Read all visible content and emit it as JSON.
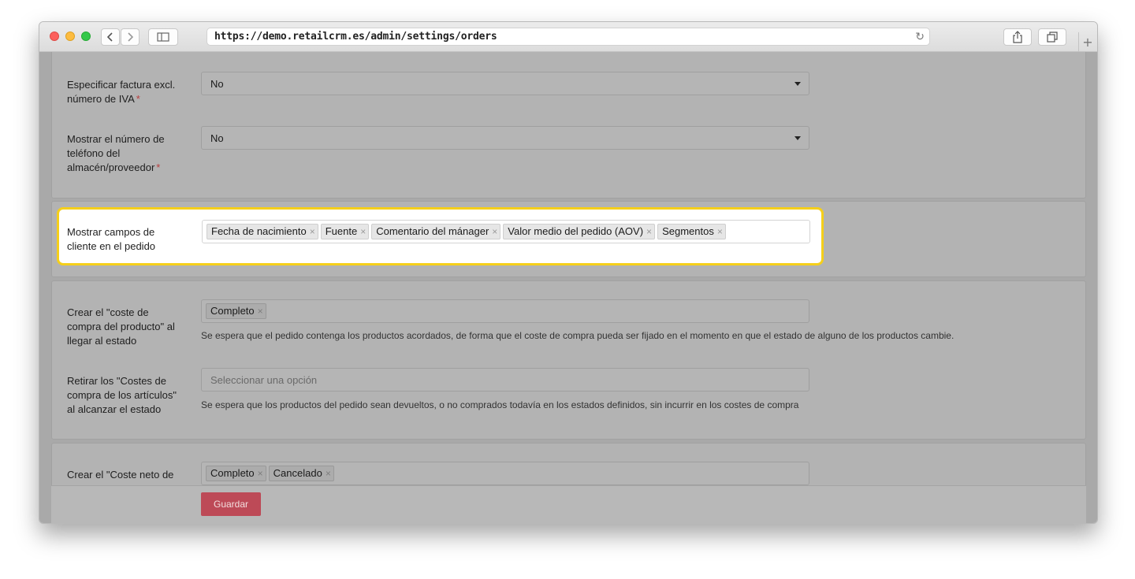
{
  "browser": {
    "url": "https://demo.retailcrm.es/admin/settings/orders",
    "reload_icon": "↻",
    "new_tab_icon": "+",
    "colors": {
      "close": "#fc605c",
      "minimize": "#fdbc40",
      "zoom": "#34c84a"
    }
  },
  "form": {
    "invoice_vat": {
      "label_line1": "Especificar factura excl.",
      "label_line2": "número de IVA",
      "required_mark": "*",
      "value": "No"
    },
    "phone": {
      "label_line1": "Mostrar el número de",
      "label_line2": "teléfono del",
      "label_line3": "almacén/proveedor",
      "required_mark": "*",
      "value": "No"
    },
    "customer_fields": {
      "label_line1": "Mostrar campos de",
      "label_line2": "cliente en el pedido",
      "tags": [
        "Fecha de nacimiento",
        "Fuente",
        "Comentario del mánager",
        "Valor medio del pedido (AOV)",
        "Segmentos"
      ]
    },
    "purchase_cost": {
      "label_line1": "Crear el \"coste de",
      "label_line2": "compra del producto\" al",
      "label_line3": "llegar al estado",
      "tags": [
        "Completo"
      ],
      "help": "Se espera que el pedido contenga los productos acordados, de forma que el coste de compra pueda ser fijado en el momento en que el estado de alguno de los productos cambie."
    },
    "withdraw_cost": {
      "label_line1": "Retirar los \"Costes de",
      "label_line2": "compra de los artículos\"",
      "label_line3": "al alcanzar el estado",
      "placeholder": "Seleccionar una opción",
      "help": "Se espera que los productos del pedido sean devueltos, o no comprados todavía en los estados definidos, sin incurrir en los costes de compra"
    },
    "net_cost": {
      "label_line1": "Crear el \"Coste neto de",
      "tags": [
        "Completo",
        "Cancelado"
      ]
    },
    "save_label": "Guardar",
    "tag_remove_icon": "×",
    "highlight_color": "#f5cf1a",
    "save_color": "#bd4a57"
  }
}
